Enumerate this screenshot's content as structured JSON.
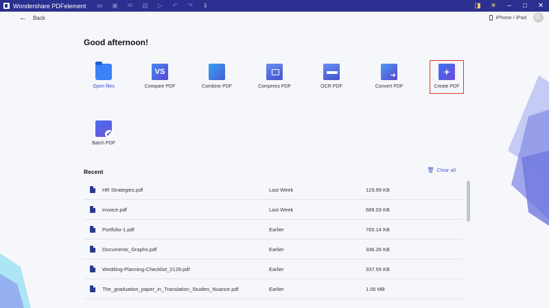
{
  "app": {
    "title": "Wondershare PDFelement"
  },
  "nav": {
    "back_label": "Back",
    "device_label": "iPhone / iPad"
  },
  "home": {
    "greeting": "Good afternoon!"
  },
  "tools": [
    {
      "label": "Open files",
      "icon": "folder-icon"
    },
    {
      "label": "Compare PDF",
      "icon": "compare-icon"
    },
    {
      "label": "Combine PDF",
      "icon": "combine-icon"
    },
    {
      "label": "Compress PDF",
      "icon": "compress-icon"
    },
    {
      "label": "OCR PDF",
      "icon": "ocr-icon"
    },
    {
      "label": "Convert PDF",
      "icon": "convert-icon"
    },
    {
      "label": "Create PDF",
      "icon": "create-icon"
    },
    {
      "label": "Batch PDF",
      "icon": "batch-icon"
    }
  ],
  "recent": {
    "title": "Recent",
    "clear_label": "Clear all",
    "files": [
      {
        "name": "HR Strategies.pdf",
        "date": "Last Week",
        "size": "129.99 KB"
      },
      {
        "name": "invoice.pdf",
        "date": "Last Week",
        "size": "689.03 KB"
      },
      {
        "name": "Portfolio-1.pdf",
        "date": "Earlier",
        "size": "765.14 KB"
      },
      {
        "name": "Documents_Graphs.pdf",
        "date": "Earlier",
        "size": "336.26 KB"
      },
      {
        "name": "Wedding-Planning-Checklist_2129.pdf",
        "date": "Earlier",
        "size": "337.59 KB"
      },
      {
        "name": "The_graduation_paper_in_Translation_Studies_Nuance.pdf",
        "date": "Earlier",
        "size": "1.06 MB"
      }
    ]
  },
  "colors": {
    "titlebar": "#2b2f8f",
    "accent": "#3a4bd8",
    "highlight": "#d6322c"
  }
}
